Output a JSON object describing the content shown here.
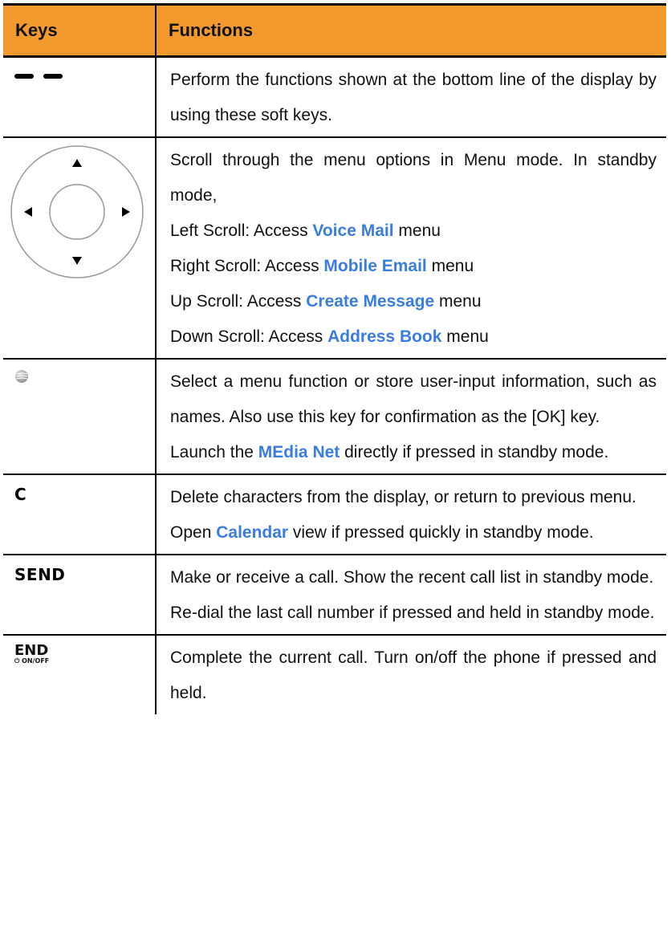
{
  "table": {
    "headers": {
      "keys": "Keys",
      "functions": "Functions"
    },
    "rows": [
      {
        "key_icon": "soft-keys-icon",
        "lines": [
          [
            {
              "t": "Perform the functions shown at the bottom line of the display by using these soft keys."
            }
          ]
        ]
      },
      {
        "key_icon": "navigation-key-icon",
        "lines": [
          [
            {
              "t": "Scroll through the menu options in Menu mode. In standby mode,"
            }
          ],
          [
            {
              "t": "Left Scroll: Access "
            },
            {
              "t": "Voice Mail",
              "h": true
            },
            {
              "t": " menu"
            }
          ],
          [
            {
              "t": "Right Scroll: Access "
            },
            {
              "t": "Mobile Email",
              "h": true
            },
            {
              "t": " menu"
            }
          ],
          [
            {
              "t": "Up Scroll: Access "
            },
            {
              "t": "Create Message",
              "h": true
            },
            {
              "t": " menu"
            }
          ],
          [
            {
              "t": "Down Scroll: Access "
            },
            {
              "t": "Address Book",
              "h": true
            },
            {
              "t": " menu"
            }
          ]
        ]
      },
      {
        "key_icon": "ok-key-globe-icon",
        "lines": [
          [
            {
              "t": "Select a menu function or store user-input information, such as names. Also use this key for confirmation as the [OK] key."
            }
          ],
          [
            {
              "t": "Launch the "
            },
            {
              "t": "MEdia Net",
              "h": true
            },
            {
              "t": " directly if pressed in standby mode."
            }
          ]
        ]
      },
      {
        "key_icon": "clear-key-icon",
        "key_label": "C",
        "lines": [
          [
            {
              "t": "Delete characters from the display, or return to previous menu."
            }
          ],
          [
            {
              "t": "Open "
            },
            {
              "t": "Calendar",
              "h": true
            },
            {
              "t": " view if pressed quickly in standby mode."
            }
          ]
        ]
      },
      {
        "key_icon": "send-key-icon",
        "key_label": "SEND",
        "lines": [
          [
            {
              "t": "Make or receive a call. Show the recent call list in standby mode."
            }
          ],
          [
            {
              "t": "Re-dial the last call number if pressed and held in standby mode."
            }
          ]
        ]
      },
      {
        "key_icon": "end-key-icon",
        "key_label": "END",
        "key_sublabel": "ON/OFF",
        "lines": [
          [
            {
              "t": "Complete the current call. Turn on/off the phone if pressed and held."
            }
          ]
        ]
      }
    ]
  },
  "colors": {
    "header_bg": "#f29a2e",
    "highlight": "#3a7de0",
    "border": "#000000"
  }
}
